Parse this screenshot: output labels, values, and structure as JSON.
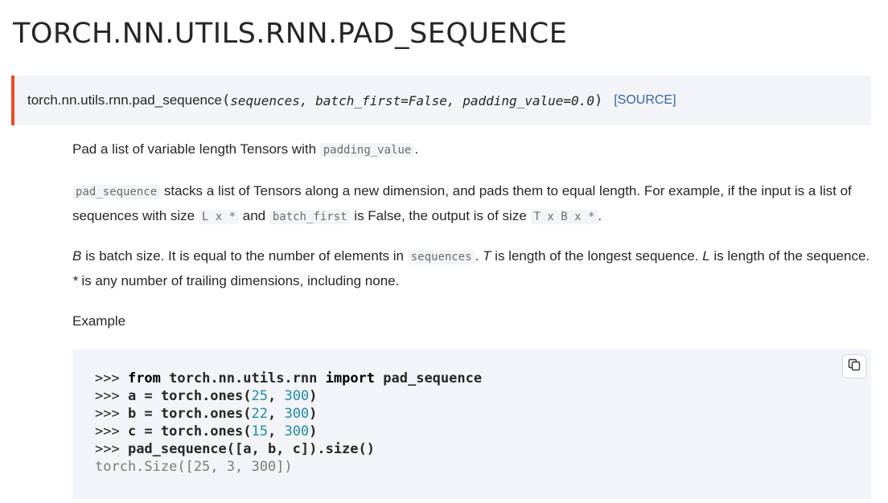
{
  "page": {
    "title": "TORCH.NN.UTILS.RNN.PAD_SEQUENCE"
  },
  "signature": {
    "name": "torch.nn.utils.rnn.pad_sequence",
    "open_paren": "(",
    "params": "sequences, batch_first=False, padding_value=0.0",
    "close_paren": ")",
    "source_label": "[SOURCE]"
  },
  "description": {
    "p1": {
      "text": "Pad a list of variable length Tensors with ",
      "code": "padding_value",
      "end": "."
    },
    "p2": {
      "code1": "pad_sequence",
      "t1": " stacks a list of Tensors along a new dimension, and pads them to equal length. For example, if the input is a list of sequences with size ",
      "code2": "L x *",
      "t2": " and ",
      "code3": "batch_first",
      "t3": " is False, the output is of size ",
      "code4": "T x B x *",
      "t4": "."
    },
    "p3": {
      "b": "B",
      "t1": " is batch size. It is equal to the number of elements in ",
      "code": "sequences",
      "t2": ". ",
      "t_var": "T",
      "t3": " is length of the longest sequence. ",
      "l": "L",
      "t4": " is length of the sequence. ",
      "star": "*",
      "t5": " is any number of trailing dimensions, including none."
    },
    "example_label": "Example"
  },
  "code_example": {
    "line1": {
      "prompt": ">>> ",
      "kw_from": "from",
      "module": " torch.nn.utils.rnn ",
      "kw_import": "import",
      "name": " pad_sequence"
    },
    "line2": {
      "prompt": ">>> ",
      "lhs": "a = torch.ones(",
      "n1": "25",
      "sep": ", ",
      "n2": "300",
      "end": ")"
    },
    "line3": {
      "prompt": ">>> ",
      "lhs": "b = torch.ones(",
      "n1": "22",
      "sep": ", ",
      "n2": "300",
      "end": ")"
    },
    "line4": {
      "prompt": ">>> ",
      "lhs": "c = torch.ones(",
      "n1": "15",
      "sep": ", ",
      "n2": "300",
      "end": ")"
    },
    "line5": {
      "prompt": ">>> ",
      "call": "pad_sequence([a, b, c]).size()"
    },
    "output": "torch.Size([25, 3, 300])",
    "copy_icon": "copy-icon"
  },
  "colors": {
    "accent_border": "#ee4c2c",
    "link": "#3465a4",
    "number": "#208ba6",
    "code_background": "#f3f4f7"
  }
}
